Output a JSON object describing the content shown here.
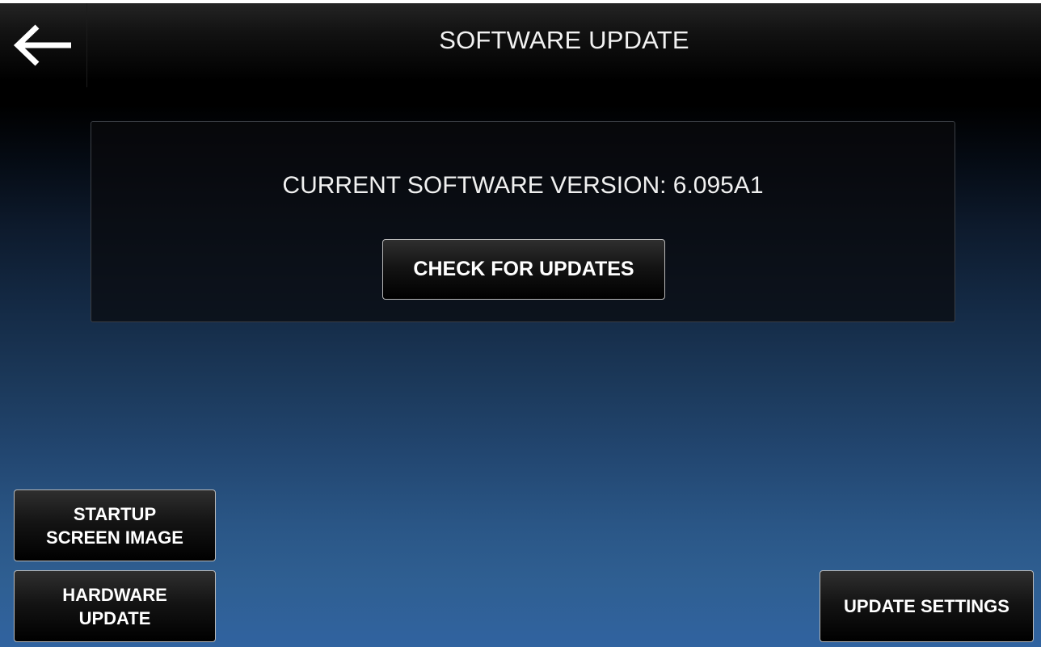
{
  "header": {
    "title": "SOFTWARE UPDATE",
    "back_icon": "left-arrow-icon"
  },
  "version_panel": {
    "version_text": "CURRENT SOFTWARE VERSION: 6.095A1",
    "check_button_label": "CHECK FOR UPDATES"
  },
  "buttons": {
    "startup_screen_image_label": "STARTUP\nSCREEN IMAGE",
    "hardware_update_label": "HARDWARE\nUPDATE",
    "update_settings_label": "UPDATE SETTINGS"
  },
  "colors": {
    "background_top": "#000000",
    "background_bottom": "#3063a0",
    "button_border": "#b9b9b9",
    "text": "#ffffff"
  }
}
